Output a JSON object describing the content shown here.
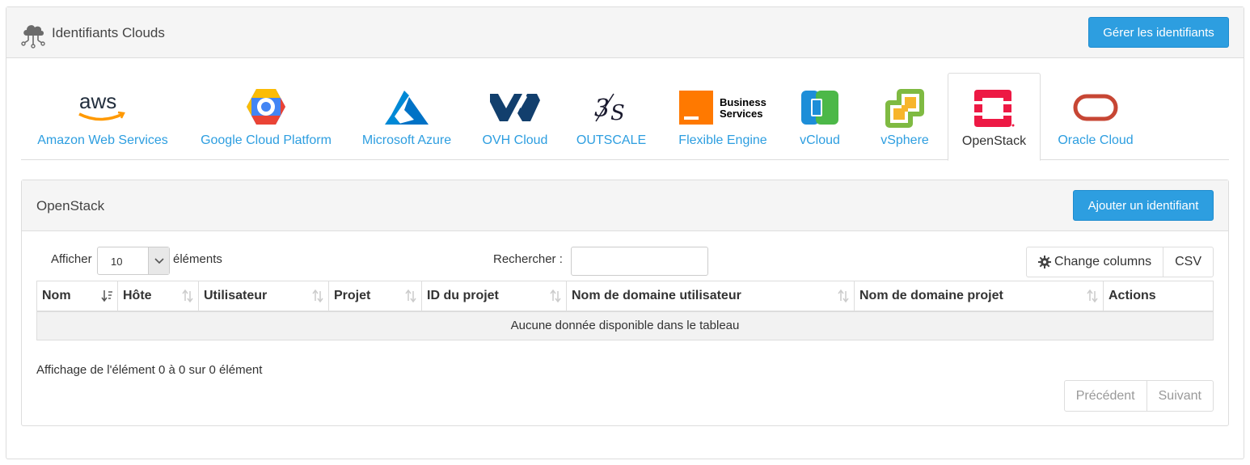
{
  "header": {
    "title": "Identifiants Clouds",
    "manage_label": "Gérer les identifiants"
  },
  "providers": [
    {
      "label": "Amazon Web Services",
      "logo_text": "aws"
    },
    {
      "label": "Google Cloud Platform"
    },
    {
      "label": "Microsoft Azure"
    },
    {
      "label": "OVH Cloud"
    },
    {
      "label": "OUTSCALE"
    },
    {
      "label": "Flexible Engine",
      "logo_text_1": "Business",
      "logo_text_2": "Services"
    },
    {
      "label": "vCloud"
    },
    {
      "label": "vSphere"
    },
    {
      "label": "OpenStack",
      "active": true
    },
    {
      "label": "Oracle Cloud"
    }
  ],
  "panel": {
    "title": "OpenStack",
    "add_label": "Ajouter un identifiant",
    "show_label": "Afficher",
    "page_size": "10",
    "elements_label": "éléments",
    "search_label": "Rechercher :",
    "search_value": "",
    "change_columns_label": "Change columns",
    "csv_label": "CSV",
    "columns": [
      "Nom",
      "Hôte",
      "Utilisateur",
      "Projet",
      "ID du projet",
      "Nom de domaine utilisateur",
      "Nom de domaine projet",
      "Actions"
    ],
    "empty_message": "Aucune donnée disponible dans le tableau",
    "info": "Affichage de l'élément 0 à 0 sur 0 élément",
    "prev_label": "Précédent",
    "next_label": "Suivant"
  },
  "colors": {
    "accent": "#2d9ee0",
    "openstack_red": "#ed1944",
    "azure_blue": "#0072c6",
    "ovh_navy": "#123f6d",
    "orange": "#ff7900",
    "oracle_red": "#c74634"
  }
}
